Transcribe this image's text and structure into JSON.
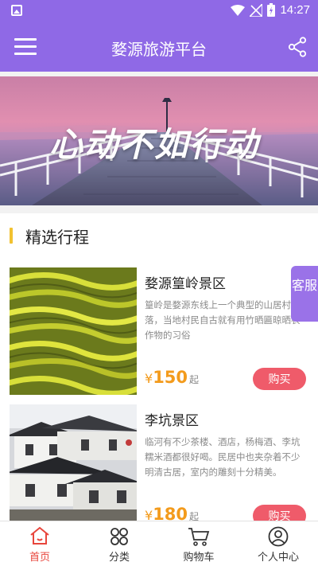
{
  "status_bar": {
    "time": "14:27"
  },
  "app_bar": {
    "title": "婺源旅游平台"
  },
  "banner": {
    "slogan": "心动不如行动"
  },
  "section": {
    "title": "精选行程"
  },
  "trips": [
    {
      "name": "婺源篁岭景区",
      "desc": "篁岭是婺源东线上一个典型的山居村落，当地村民自古就有用竹晒匾晾晒农作物的习俗",
      "currency": "¥",
      "price": "150",
      "unit": "起",
      "buy_label": "购买"
    },
    {
      "name": "李坑景区",
      "desc": "临河有不少茶楼、酒店，杨梅酒、李坑糯米酒都很好喝。民居中也夹杂着不少明清古居，室内的雕刻十分精美。",
      "currency": "¥",
      "price": "180",
      "unit": "起",
      "buy_label": "购买"
    }
  ],
  "service_tab": {
    "label": "客服"
  },
  "bottom_nav": [
    {
      "label": "首页",
      "icon": "home-icon",
      "active": true
    },
    {
      "label": "分类",
      "icon": "category-icon",
      "active": false
    },
    {
      "label": "购物车",
      "icon": "cart-icon",
      "active": false
    },
    {
      "label": "个人中心",
      "icon": "user-icon",
      "active": false
    }
  ],
  "colors": {
    "primary": "#8f69e6",
    "accent": "#ef5b6a",
    "price": "#f39b1c",
    "active_nav": "#e8453c"
  }
}
